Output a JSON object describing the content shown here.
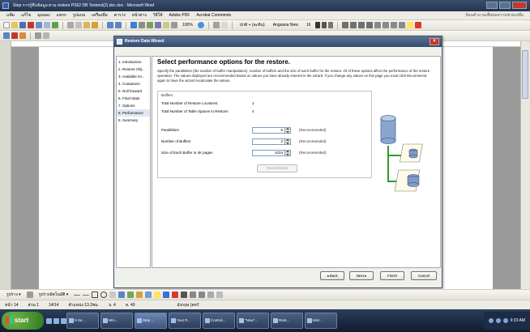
{
  "word": {
    "title": "Step การกู้คืนข้อมูล ตาม restore   PS62 DB Testrest(2).doc.doc - Microsoft Word",
    "menu": [
      "แฟ้ม",
      "แก้ไข",
      "มุมมอง",
      "แทรก",
      "รูปแบบ",
      "เครื่องมือ",
      "ตาราง",
      "หน้าต่าง",
      "วิธีใช้",
      "Adobe PDF",
      "Acrobat Comments"
    ],
    "help_placeholder": "ป้อนคำถามเพื่อขอความช่วยเหลือ",
    "zoom": "100%",
    "style_name": "ปกติ + (ละติน)",
    "font_name": "Angsana New",
    "font_size": "16",
    "status": {
      "page": "หน้า 14",
      "section": "ส่วน 1",
      "page_of": "14/14",
      "position": "ตำแหน่ง 13.2ซม.",
      "line": "บ. 4",
      "column": "ค. 40",
      "language": "อังกฤษ (สหรั"
    },
    "drawbar": {
      "draw_label": "รูปร่าง ▾",
      "autoshapes_label": "รูปร่างอัตโนมัติ ▾"
    }
  },
  "dialog": {
    "title": "Restore Data Wizard",
    "close_glyph": "×",
    "nav": [
      "1. Introduction",
      "2. Restore Obj...",
      "3. Available im...",
      "4. Containers",
      "5. Roll forward",
      "6. Final State",
      "7. Options",
      "8. Performance",
      "9. Summary"
    ],
    "selected_nav_index": 7,
    "heading": "Select performance options for the restore.",
    "description": "Specify the parallelism (the number of buffer manipulators), number of buffers and the size of each buffer for the restore. All of these options affect the performance of the restore operation. The values displayed are recommended based on values you have already entered in the wizard. If you change any values on this page you must click Recommend again to have the wizard recalculate the values.",
    "buffers_group": {
      "title": "Buffers",
      "total_locations_label": "Total Number of Restore Locations:",
      "total_locations_value": "1",
      "total_tablespaces_label": "Total Number of Table Spaces to Restore:",
      "total_tablespaces_value": "4"
    },
    "fields": [
      {
        "label": "Parallelism",
        "value": "6",
        "note": "(Recommended)"
      },
      {
        "label": "Number of Buffers",
        "value": "2",
        "note": "(Recommended)"
      },
      {
        "label": "Size of Each Buffer in 4K pages",
        "value": "1024",
        "note": "(Recommended)"
      }
    ],
    "recommend_label": "Recommend",
    "buttons": {
      "back": "◂ Back",
      "next": "Next ▸",
      "finish": "Finish",
      "cancel": "Cancel"
    }
  },
  "taskbar": {
    "start_label": "start",
    "tasks": [
      "9 Se...",
      "Win...",
      "Step ...",
      "Your P...",
      "Control...",
      "\"New\"...",
      "Rest...",
      "Micr..."
    ],
    "clock": "9:33 AM"
  },
  "colors": {
    "title_bar": "#34496d",
    "dialog_bg": "#f0f0ea",
    "nav_selected": "#dfe8f4",
    "taskbar": "#1c2c47",
    "start_green": "#2f7a1e",
    "db_cylinder": "#8aa6cf",
    "arrow_green": "#2e9a2e"
  }
}
